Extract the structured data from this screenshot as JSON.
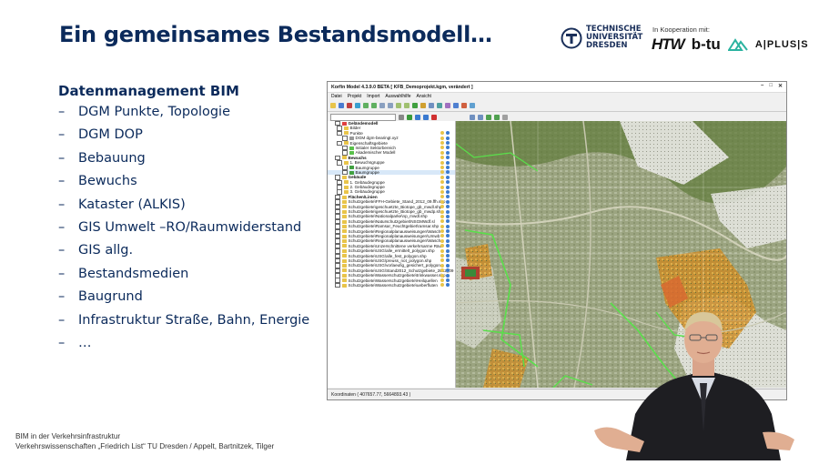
{
  "slide": {
    "title": "Ein gemeinsames Bestandsmodell…",
    "heading": "Datenmanagement  BIM",
    "bullets": [
      "DGM Punkte, Topologie",
      "DGM DOP",
      "Bebauung",
      "Bewuchs",
      "Kataster (ALKIS)",
      "GIS Umwelt –RO/Raumwiderstand",
      "GIS allg.",
      "Bestandsmedien",
      "Baugrund",
      "Infrastruktur Straße, Bahn, Energie",
      "…"
    ],
    "bullet_dash": "–"
  },
  "logos": {
    "tud_line1": "TECHNISCHE",
    "tud_line2": "UNIVERSITÄT",
    "tud_line3": "DRESDEN",
    "coop_label": "In Kooperation mit:",
    "htw": "HTW",
    "btu": "b-tu",
    "aplus": "A|PLUS|S"
  },
  "footer": {
    "line1": "BIM in der Verkehrsinfrastruktur",
    "line2": "Verkehrswissenschaften „Friedrich List“ TU Dresden / Appelt, Bartnitzek, Tilger"
  },
  "app": {
    "title": "Korfin Model 4.3.9.0 BETA [ KFB_Demoprojekt.kgm, verändert ]",
    "window_buttons": [
      "–",
      "□",
      "✕"
    ],
    "menu": [
      "Datei",
      "Projekt",
      "Import",
      "Auswahlhilfe",
      "Ansicht"
    ],
    "tree": [
      {
        "label": "Geländemodell",
        "bold": true
      },
      {
        "label": "Bilder"
      },
      {
        "label": "Punkte"
      },
      {
        "label": "DGM dgm-bearingt.xyz"
      },
      {
        "label": "Eigenschaftsgebiete"
      },
      {
        "label": "Initialer Sektorbereich"
      },
      {
        "label": "Akademischer Modell"
      },
      {
        "label": "Bewuchs",
        "bold": true
      },
      {
        "label": "1. Bewuchsgruppe"
      },
      {
        "label": "Baumgruppe"
      },
      {
        "label": "Baumgruppe",
        "selected": true
      },
      {
        "label": "Gebäude",
        "bold": true
      },
      {
        "label": "1. Gebäudegruppe"
      },
      {
        "label": "2. Gebäudegruppe"
      },
      {
        "label": "3. Gebäudegruppe"
      },
      {
        "label": "Flächen/Linien",
        "bold": true
      },
      {
        "label": "Schutzgebiete\\FFH-Gebiete_Stand_2012_09.ffh.shp"
      },
      {
        "label": "Schutzgebiete\\geschuetzte_Biotope_gb_mwdl.shp"
      },
      {
        "label": "Schutzgebiete\\geschuetzte_Biotope_gb_mwdp.shp"
      },
      {
        "label": "Schutzgebiete\\Nationalparke\\np_mwdl.shp"
      },
      {
        "label": "Schutzgebiete\\Naturschutzgebiet\\NSGMWdf.sl"
      },
      {
        "label": "Schutzgebiete\\Ramsar_Feuchtgebiet\\ramsar.shp"
      },
      {
        "label": "Schutzgebiete\\Regionalplanausweisungen\\Wasch"
      },
      {
        "label": "Schutzgebiete\\Regionalplanausweisungen\\Umwb"
      },
      {
        "label": "Schutzgebiete\\Regionalplanausweisungen\\Wasch"
      },
      {
        "label": "Schutzgebiete\\Unzerschnittene verkehrsarme Räu"
      },
      {
        "label": "Schutzgebiete\\USG\\alle_ermittelt_polygon.shp"
      },
      {
        "label": "Schutzgebiete\\USG\\alle_fest_polygon.shp"
      },
      {
        "label": "Schutzgebiete\\USG\\preuss_not_polygon.shp"
      },
      {
        "label": "Schutzgebiete\\USG\\vorlaeufig_gesichert_polygon"
      },
      {
        "label": "Schutzgebiete\\USG\\Stand2012_Schutzgebiete_2012_09"
      },
      {
        "label": "Schutzgebiete\\Wasserschutzgebiete\\trinkwasser.shp"
      },
      {
        "label": "Schutzgebiete\\Wasserschutzgebiete\\Heilquellen"
      },
      {
        "label": "Schutzgebiete\\Wasserschutzgebiete\\ueberfluten"
      }
    ],
    "status": "Koordinaten     ( 407657.77, 5664893.43 )"
  },
  "colors": {
    "title_blue": "#0b2a5b",
    "accent_green": "#4caf50",
    "accent_orange": "#e8a020"
  }
}
